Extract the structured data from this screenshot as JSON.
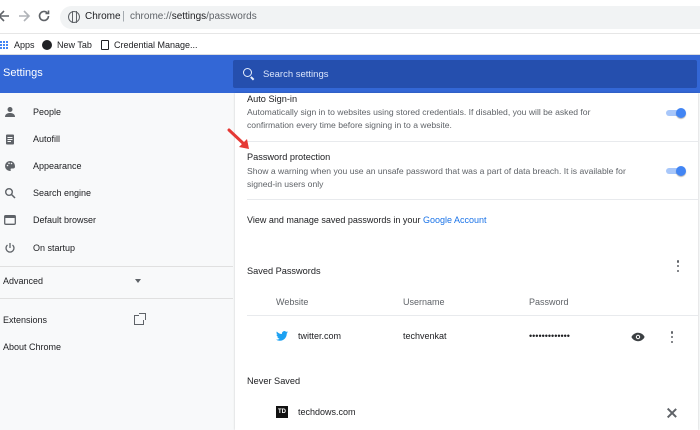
{
  "browser": {
    "omnibox_label": "Chrome",
    "url_scheme": "chrome://",
    "url_host": "settings",
    "url_path": "/passwords",
    "separator": "|"
  },
  "bookmarks": [
    {
      "label": "Apps",
      "icon": "apps-grid-icon"
    },
    {
      "label": "New Tab",
      "icon": "new-tab-icon"
    },
    {
      "label": "Credential Manage...",
      "icon": "document-icon"
    }
  ],
  "header": {
    "title": "Settings",
    "search_placeholder": "Search settings"
  },
  "sidebar": {
    "items": [
      {
        "label": "People",
        "icon": "person-icon"
      },
      {
        "label": "Autofill",
        "icon": "clipboard-icon"
      },
      {
        "label": "Appearance",
        "icon": "palette-icon"
      },
      {
        "label": "Search engine",
        "icon": "search-icon"
      },
      {
        "label": "Default browser",
        "icon": "browser-window-icon"
      },
      {
        "label": "On startup",
        "icon": "power-icon"
      }
    ],
    "advanced_label": "Advanced",
    "extensions_label": "Extensions",
    "about_label": "About Chrome"
  },
  "main": {
    "auto_signin": {
      "title": "Auto Sign-in",
      "description": "Automatically sign in to websites using stored credentials. If disabled, you will be asked for confirmation every time before signing in to a website.",
      "enabled": true
    },
    "password_protection": {
      "title": "Password protection",
      "description": "Show a warning when you use an unsafe password that was a part of data breach. It is available for signed-in users only",
      "enabled": true
    },
    "manage_text": "View and manage saved passwords in your",
    "manage_link": "Google Account",
    "saved_passwords": {
      "heading": "Saved Passwords",
      "columns": [
        "Website",
        "Username",
        "Password"
      ],
      "rows": [
        {
          "website": "twitter.com",
          "username": "techvenkat",
          "password": "•••••••••••••",
          "icon": "twitter-icon"
        }
      ]
    },
    "never_saved": {
      "heading": "Never Saved",
      "rows": [
        {
          "website": "techdows.com",
          "icon_text": "TD"
        }
      ]
    }
  },
  "colors": {
    "header_blue": "#3367d6",
    "search_blue": "#254fae",
    "toggle_on": "#4285f4",
    "link": "#1a73e8",
    "annotation_arrow": "#e53935"
  }
}
